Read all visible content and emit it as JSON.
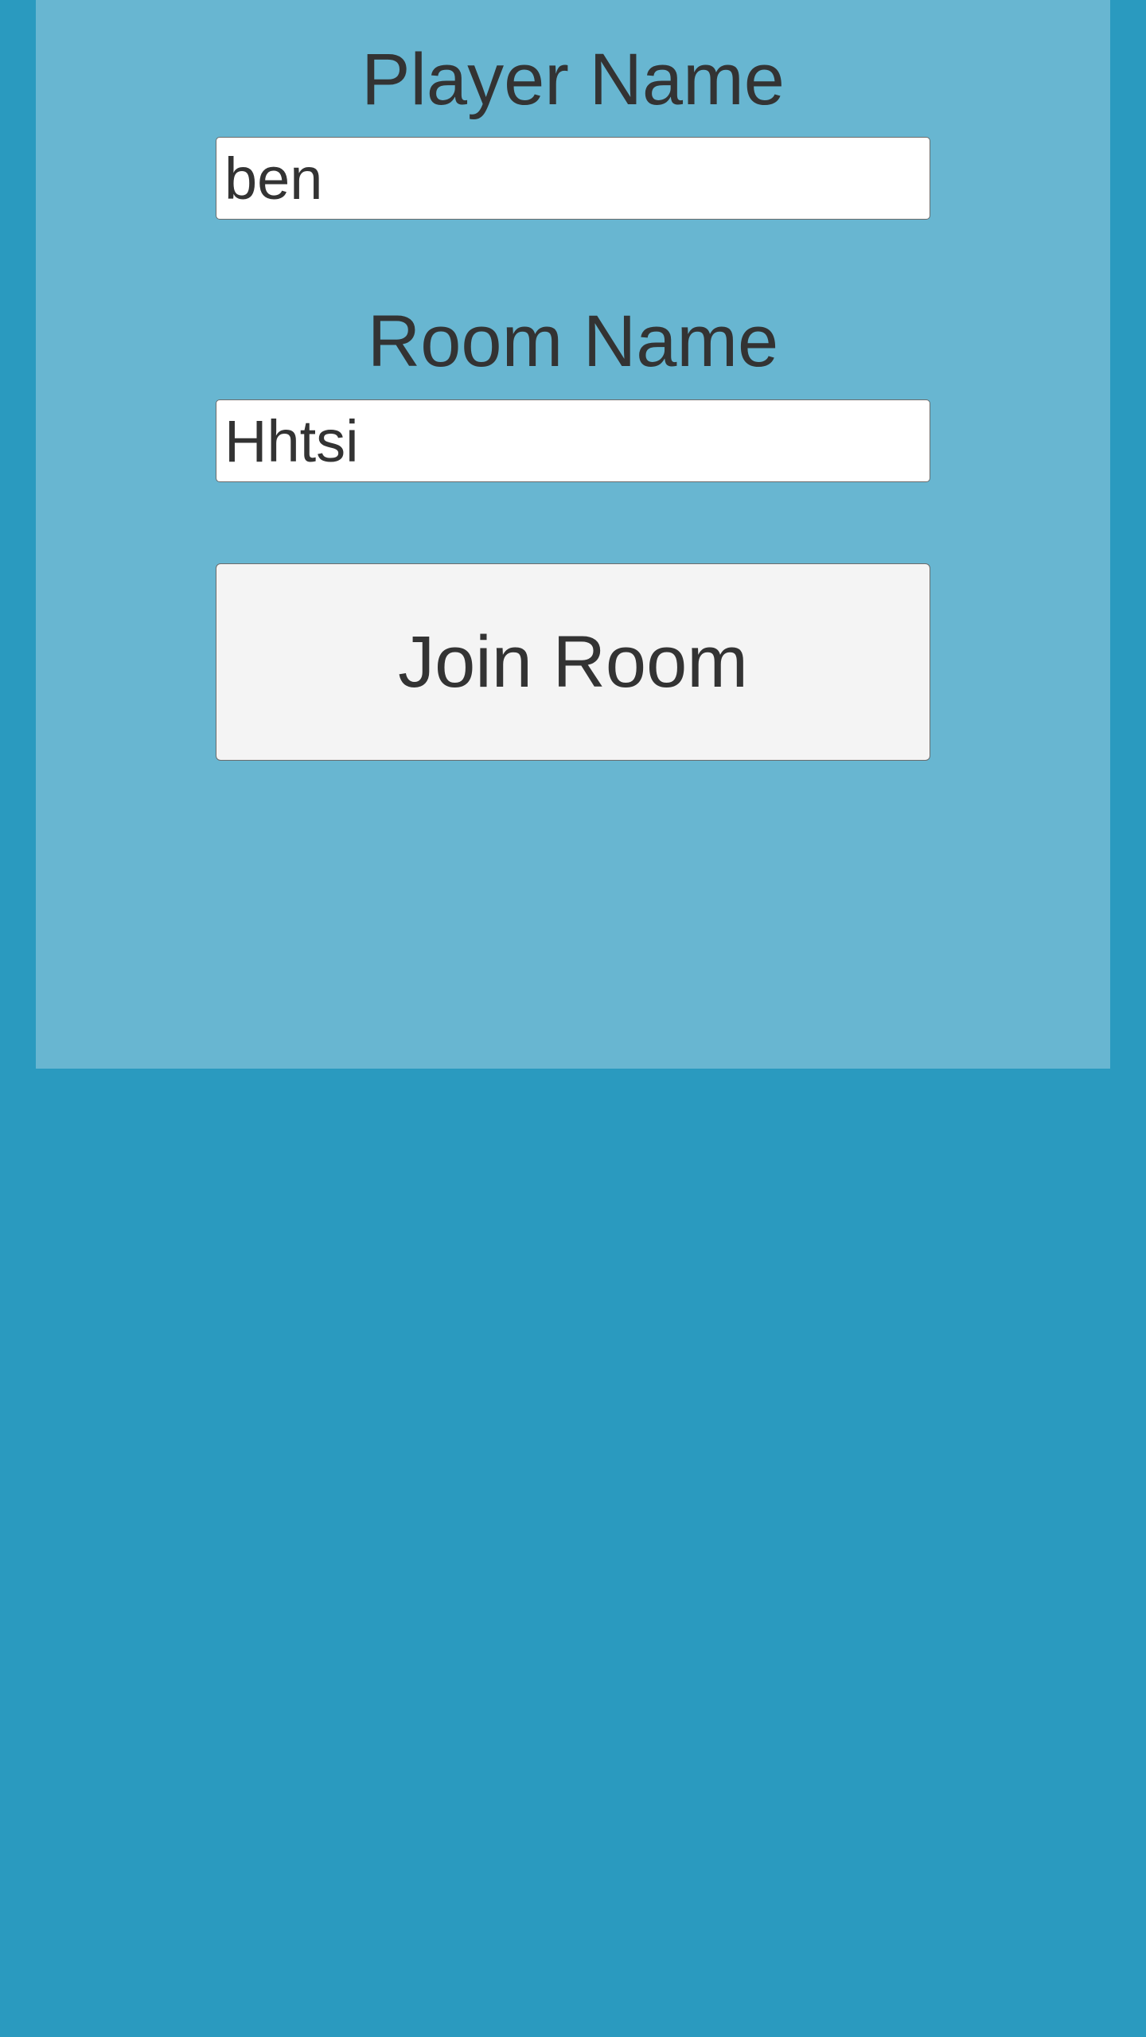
{
  "form": {
    "player_label": "Player Name",
    "player_value": "ben",
    "room_label": "Room Name",
    "room_value": "Hhtsi",
    "join_label": "Join Room"
  },
  "colors": {
    "background": "#2a9abf",
    "panel": "#68b6d1",
    "text": "#333333",
    "button": "#f4f4f4"
  }
}
